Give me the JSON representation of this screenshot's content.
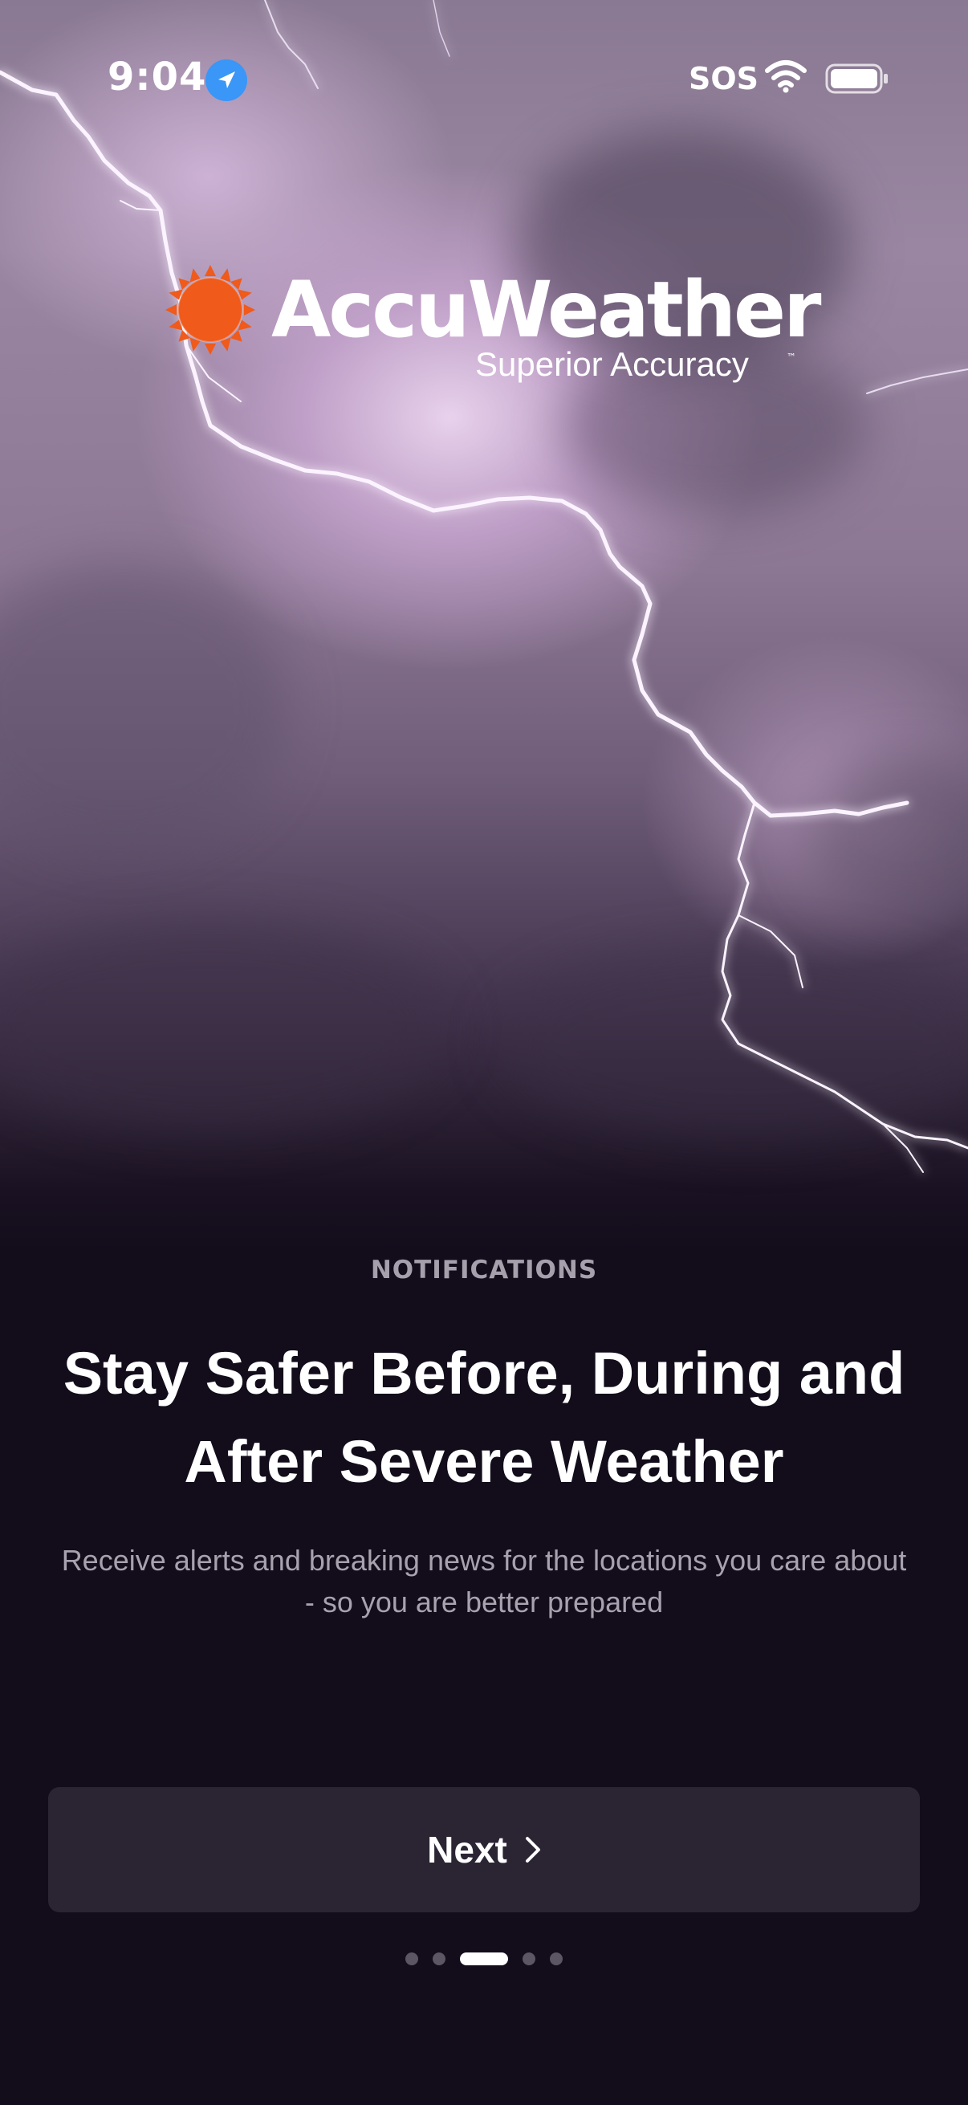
{
  "status_bar": {
    "time": "9:04",
    "location_icon": "location-arrow-icon",
    "sos": "SOS",
    "wifi_icon": "wifi-icon",
    "battery_icon": "battery-icon"
  },
  "logo": {
    "wordmark": "AccuWeather",
    "registered": "®",
    "tagline": "Superior Accuracy",
    "trademark": "™",
    "icon": "sun-icon",
    "color": "#f05a1a"
  },
  "onboarding": {
    "eyebrow": "NOTIFICATIONS",
    "headline": "Stay Safer Before, During and After Severe Weather",
    "subtext": "Receive alerts and breaking news for the locations you care about - so you are better prepared",
    "next_label": "Next",
    "next_icon": "chevron-right-icon",
    "page_count": 5,
    "current_page": 3
  },
  "colors": {
    "background": "#120c1b",
    "button": "#2b2433",
    "accent": "#f05a1a",
    "location_blue": "#3a96f7"
  }
}
